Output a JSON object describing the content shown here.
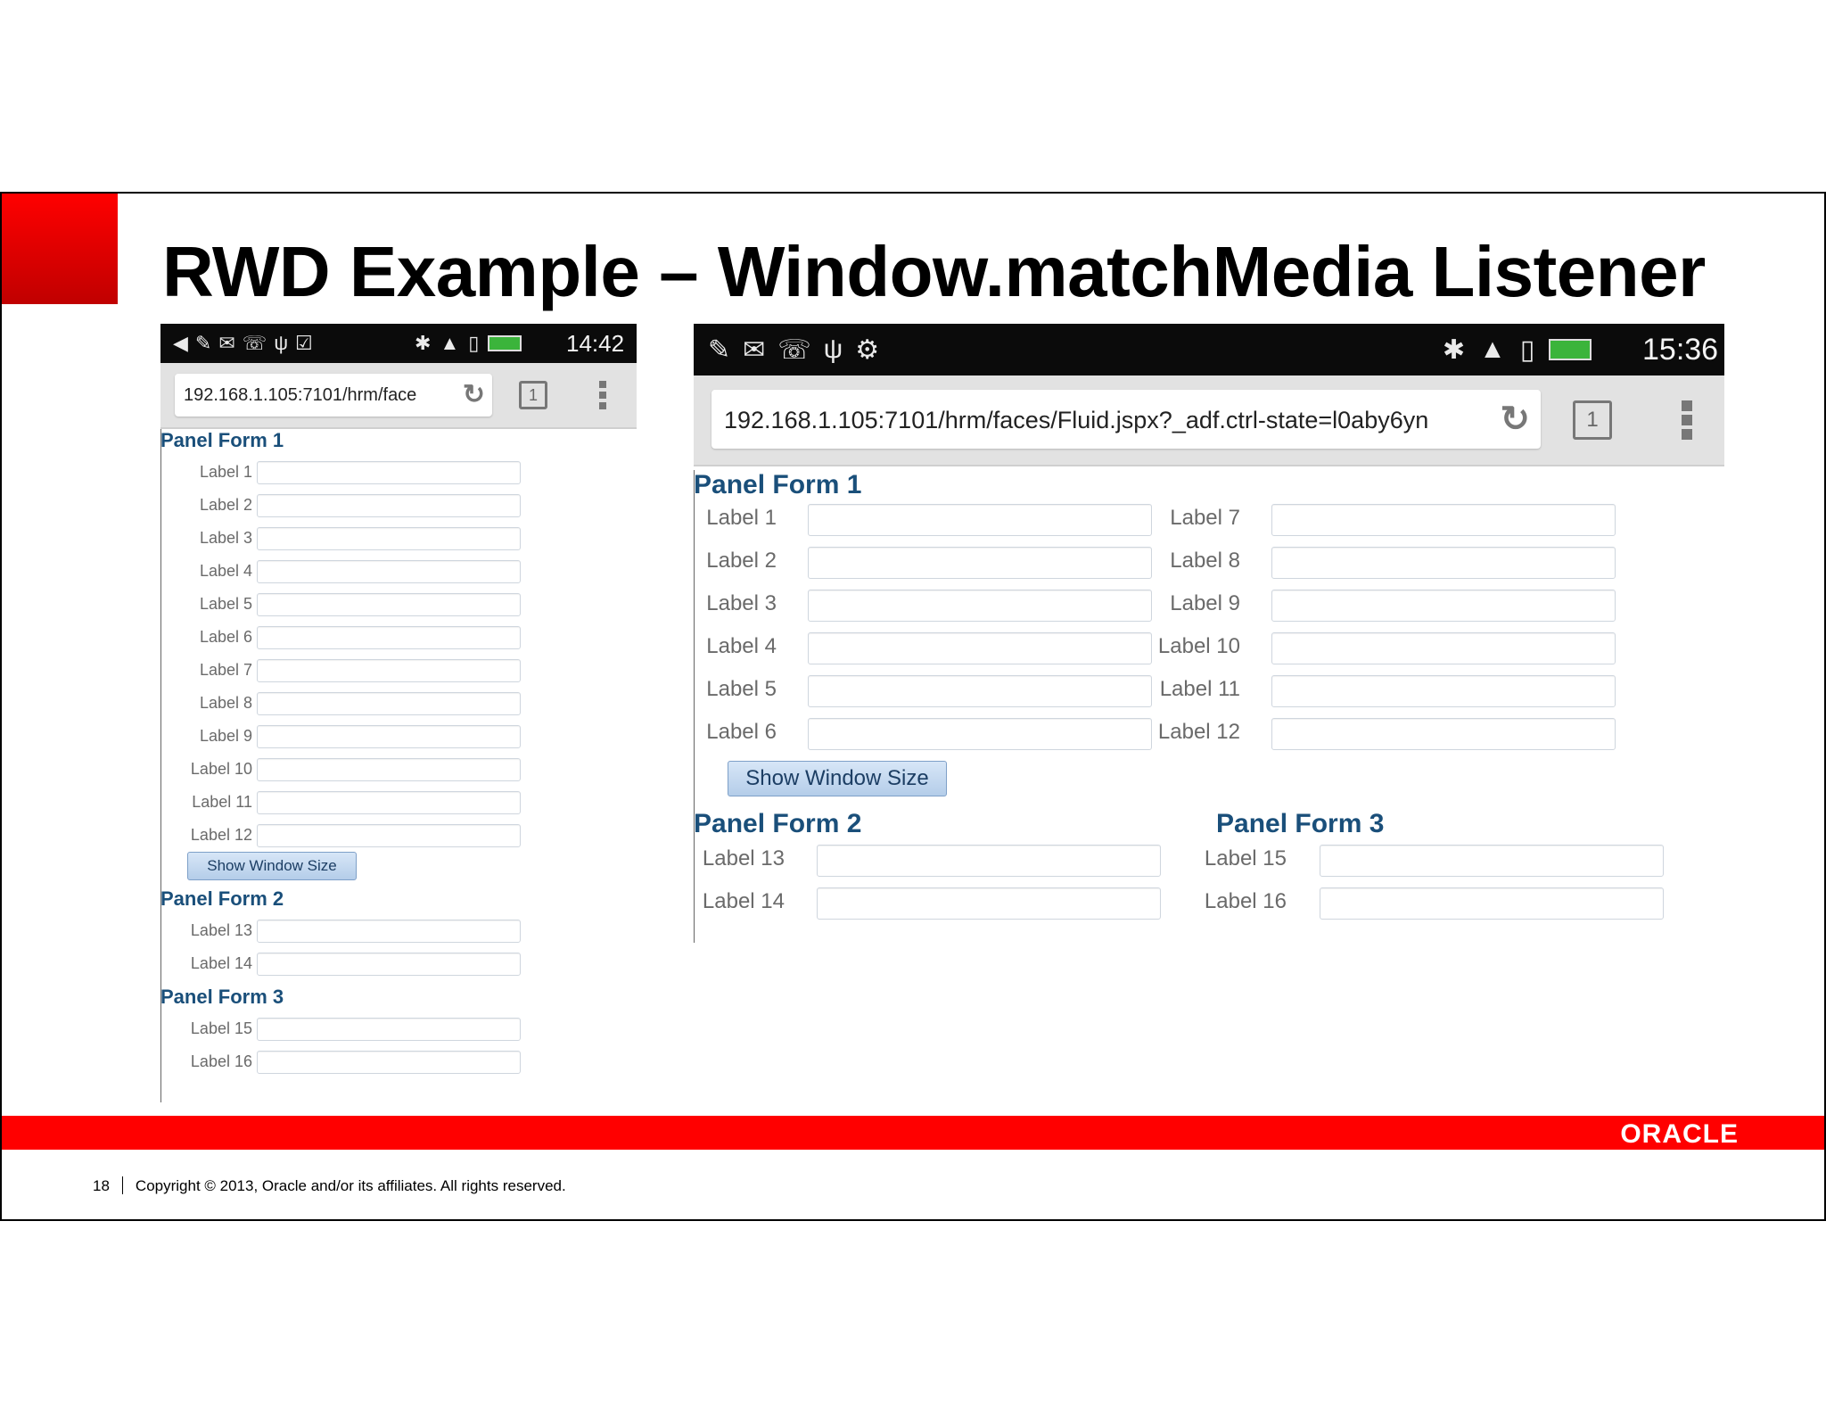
{
  "slide": {
    "title": "RWD Example – Window.matchMedia Listener",
    "page_number": "18",
    "copyright": "Copyright © 2013, Oracle and/or its affiliates. All rights reserved.",
    "logo_text": "ORACLE"
  },
  "colors": {
    "oracle_red": "#ff0000",
    "panel_title": "#1a4f7a",
    "button_fill": "#c6daf0"
  },
  "phone_narrow": {
    "time": "14:42",
    "url": "192.168.1.105:7101/hrm/face",
    "tab_count": "1",
    "panel1_title": "Panel Form 1",
    "panel1_labels": [
      "Label 1",
      "Label 2",
      "Label 3",
      "Label 4",
      "Label 5",
      "Label 6",
      "Label 7",
      "Label 8",
      "Label 9",
      "Label 10",
      "Label 11",
      "Label 12"
    ],
    "button_label": "Show Window Size",
    "panel2_title": "Panel Form 2",
    "panel2_labels": [
      "Label 13",
      "Label 14"
    ],
    "panel3_title": "Panel Form 3",
    "panel3_labels": [
      "Label 15",
      "Label 16"
    ]
  },
  "phone_wide": {
    "time": "15:36",
    "url": "192.168.1.105:7101/hrm/faces/Fluid.jspx?_adf.ctrl-state=l0aby6yn",
    "tab_count": "1",
    "panel1_title": "Panel Form 1",
    "panel1_col1_labels": [
      "Label 1",
      "Label 2",
      "Label 3",
      "Label 4",
      "Label 5",
      "Label 6"
    ],
    "panel1_col2_labels": [
      "Label 7",
      "Label 8",
      "Label 9",
      "Label 10",
      "Label 11",
      "Label 12"
    ],
    "button_label": "Show Window Size",
    "panel2_title": "Panel Form 2",
    "panel2_labels": [
      "Label 13",
      "Label 14"
    ],
    "panel3_title": "Panel Form 3",
    "panel3_labels": [
      "Label 15",
      "Label 16"
    ]
  }
}
